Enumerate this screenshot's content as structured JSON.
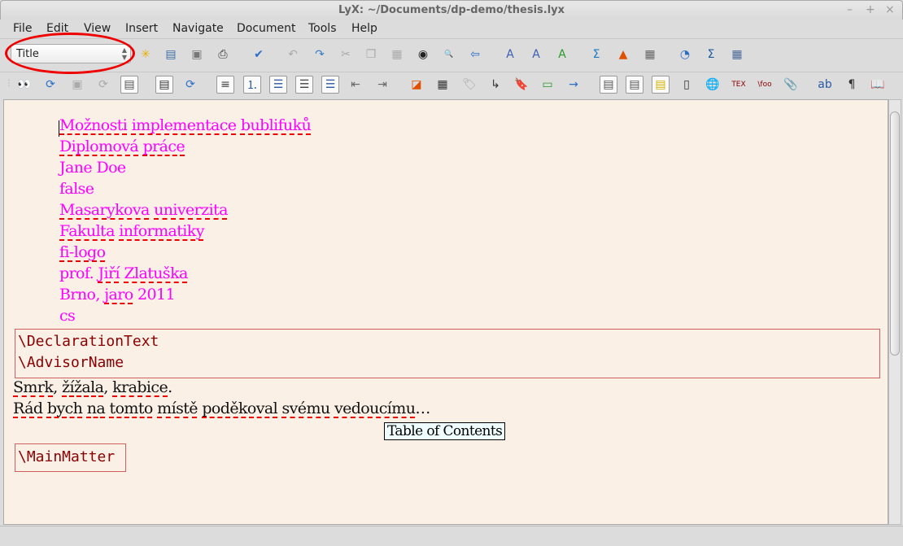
{
  "window": {
    "title": "LyX: ~/Documents/dp-demo/thesis.lyx",
    "minimize": "–",
    "maximize": "+",
    "close": "×"
  },
  "menu": [
    "File",
    "Edit",
    "View",
    "Insert",
    "Navigate",
    "Document",
    "Tools",
    "Help"
  ],
  "layout_select": {
    "value": "Title"
  },
  "toolbar1": [
    {
      "name": "new-document-icon",
      "g": "✳",
      "c": "#e8b000"
    },
    {
      "name": "open-document-icon",
      "g": "▤",
      "c": "#3a6ea5"
    },
    {
      "name": "save-icon",
      "g": "▣",
      "c": "#777"
    },
    {
      "name": "print-icon",
      "g": "⎙",
      "c": "#333"
    },
    {
      "name": "spellcheck-icon",
      "g": "✔",
      "c": "#2a6ec8"
    },
    {
      "name": "undo-icon",
      "g": "↶",
      "c": "#aaa"
    },
    {
      "name": "redo-icon",
      "g": "↷",
      "c": "#3a7ec5"
    },
    {
      "name": "cut-icon",
      "g": "✂",
      "c": "#aaa"
    },
    {
      "name": "copy-icon",
      "g": "❐",
      "c": "#aaa"
    },
    {
      "name": "paste-icon",
      "g": "▦",
      "c": "#aaa"
    },
    {
      "name": "find-replace-icon",
      "g": "◉",
      "c": "#222"
    },
    {
      "name": "search-icon",
      "g": "🔍",
      "c": "#333"
    },
    {
      "name": "navigate-back-icon",
      "g": "⇦",
      "c": "#2a6ec8"
    },
    {
      "name": "emphasis-icon",
      "g": "A",
      "c": "#3a5eb5"
    },
    {
      "name": "noun-icon",
      "g": "A",
      "c": "#3a5eb5"
    },
    {
      "name": "apply-style-icon",
      "g": "A",
      "c": "#2a9a2a"
    },
    {
      "name": "math-icon",
      "g": "Σ",
      "c": "#1a7ac8"
    },
    {
      "name": "insert-graphics-icon",
      "g": "▲",
      "c": "#e05000"
    },
    {
      "name": "insert-table-icon",
      "g": "▦",
      "c": "#666"
    },
    {
      "name": "navigator-icon",
      "g": "◔",
      "c": "#2a6ec8"
    },
    {
      "name": "math-panel-icon",
      "g": "Σ",
      "c": "#1a5a9a"
    },
    {
      "name": "table-panel-icon",
      "g": "▦",
      "c": "#4a6a9a"
    }
  ],
  "toolbar2": [
    {
      "name": "view-icon",
      "g": "👀",
      "c": "#000"
    },
    {
      "name": "update-icon",
      "g": "⟳",
      "c": "#2a6ec8"
    },
    {
      "name": "view-master-icon",
      "g": "▣",
      "c": "#aaa"
    },
    {
      "name": "update-master-icon",
      "g": "⟳",
      "c": "#aaa"
    },
    {
      "name": "export-icon",
      "g": "▤",
      "c": "#555"
    },
    {
      "name": "view-other-icon",
      "g": "▤",
      "c": "#333"
    },
    {
      "name": "update-other-icon",
      "g": "⟳",
      "c": "#2a6ec8"
    },
    {
      "name": "paragraph-standard-icon",
      "g": "≡",
      "c": "#444"
    },
    {
      "name": "enumerate-icon",
      "g": "⒈",
      "c": "#2a5aa5"
    },
    {
      "name": "itemize-icon",
      "g": "☰",
      "c": "#2a5aa5"
    },
    {
      "name": "description-icon",
      "g": "☰",
      "c": "#444"
    },
    {
      "name": "list-icon",
      "g": "☰",
      "c": "#2a5aa5"
    },
    {
      "name": "depth-decrease-icon",
      "g": "⇤",
      "c": "#666"
    },
    {
      "name": "depth-increase-icon",
      "g": "⇥",
      "c": "#666"
    },
    {
      "name": "float-figure-icon",
      "g": "◪",
      "c": "#e05000"
    },
    {
      "name": "float-table-icon",
      "g": "▦",
      "c": "#333"
    },
    {
      "name": "label-icon",
      "g": "🏷",
      "c": "#aaa"
    },
    {
      "name": "cross-reference-icon",
      "g": "↳",
      "c": "#333"
    },
    {
      "name": "bookmark-icon",
      "g": "🔖",
      "c": "#3a5a8a"
    },
    {
      "name": "index-entry-icon",
      "g": "▭",
      "c": "#2a9a2a"
    },
    {
      "name": "nomenclature-icon",
      "g": "→",
      "c": "#2a6ec8"
    },
    {
      "name": "footnote-icon",
      "g": "▤",
      "c": "#555"
    },
    {
      "name": "margin-note-icon",
      "g": "▤",
      "c": "#555"
    },
    {
      "name": "note-icon",
      "g": "▤",
      "c": "#d8b000"
    },
    {
      "name": "box-icon",
      "g": "▯",
      "c": "#333"
    },
    {
      "name": "hyperlink-icon",
      "g": "🌐",
      "c": "#2a8a2a"
    },
    {
      "name": "tex-code-icon",
      "g": "TEX",
      "c": "#8b0000"
    },
    {
      "name": "math-macro-icon",
      "g": "\\foo",
      "c": "#8b0000"
    },
    {
      "name": "attach-icon",
      "g": "📎",
      "c": "#aaa"
    },
    {
      "name": "font-style-icon",
      "g": "ab",
      "c": "#2a5aa5"
    },
    {
      "name": "paragraph-settings-icon",
      "g": "¶",
      "c": "#333"
    },
    {
      "name": "toggle-toc-icon",
      "g": "📖",
      "c": "#8b0000"
    }
  ],
  "document": {
    "title_lines": [
      [
        {
          "t": "Možnosti",
          "e": true
        },
        {
          "t": " "
        },
        {
          "t": "implementace",
          "e": true
        },
        {
          "t": " "
        },
        {
          "t": "bublifuků",
          "e": true
        }
      ],
      [
        {
          "t": "Diplomová",
          "e": true
        },
        {
          "t": " "
        },
        {
          "t": "práce",
          "e": true
        }
      ],
      [
        {
          "t": "Jane Doe"
        }
      ],
      [
        {
          "t": "false"
        }
      ],
      [
        {
          "t": "Masarykova",
          "e": true
        },
        {
          "t": " "
        },
        {
          "t": "univerzita",
          "e": true
        }
      ],
      [
        {
          "t": "Fakulta",
          "e": true
        },
        {
          "t": " "
        },
        {
          "t": "informatiky",
          "e": true
        }
      ],
      [
        {
          "t": "fi-logo",
          "e": true
        }
      ],
      [
        {
          "t": "prof. "
        },
        {
          "t": "Jiří",
          "e": true
        },
        {
          "t": " "
        },
        {
          "t": "Zlatuška",
          "e": true
        }
      ],
      [
        {
          "t": "Brno, "
        },
        {
          "t": "jaro",
          "e": true
        },
        {
          "t": " 2011"
        }
      ],
      [
        {
          "t": "cs"
        }
      ]
    ],
    "ert_block": [
      "\\DeclarationText",
      "\\AdvisorName"
    ],
    "body_lines": [
      [
        {
          "t": "Smrk",
          "e": true
        },
        {
          "t": ", "
        },
        {
          "t": "žížala",
          "e": true
        },
        {
          "t": ", "
        },
        {
          "t": "krabice",
          "e": true
        },
        {
          "t": "."
        }
      ],
      [
        {
          "t": "Rád",
          "e": true
        },
        {
          "t": " "
        },
        {
          "t": "bych",
          "e": true
        },
        {
          "t": " "
        },
        {
          "t": "na",
          "e": true
        },
        {
          "t": " "
        },
        {
          "t": "tomto",
          "e": true
        },
        {
          "t": " "
        },
        {
          "t": "místě",
          "e": true
        },
        {
          "t": " "
        },
        {
          "t": "poděkoval",
          "e": true
        },
        {
          "t": " "
        },
        {
          "t": "svému",
          "e": true
        },
        {
          "t": " "
        },
        {
          "t": "vedoucímu",
          "e": true
        },
        {
          "t": "…"
        }
      ]
    ],
    "toc_label": "Table of Contents",
    "main_matter": "\\MainMatter"
  }
}
